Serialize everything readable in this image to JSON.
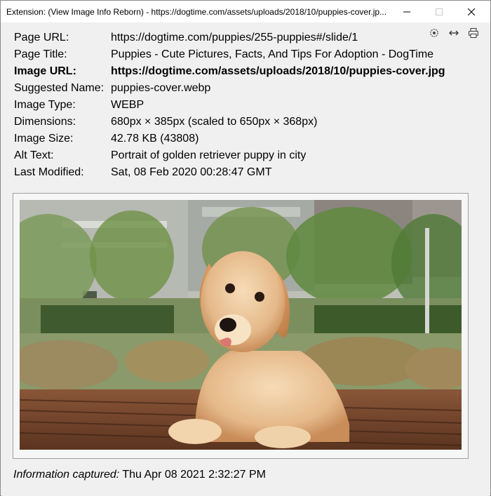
{
  "window": {
    "title": "Extension: (View Image Info Reborn) - https://dogtime.com/assets/uploads/2018/10/puppies-cover.jp..."
  },
  "info": [
    {
      "label": "Page URL:",
      "value": "https://dogtime.com/puppies/255-puppies#/slide/1",
      "bold": false
    },
    {
      "label": "Page Title:",
      "value": "Puppies - Cute Pictures, Facts, And Tips For Adoption - DogTime",
      "bold": false
    },
    {
      "label": "Image URL:",
      "value": "https://dogtime.com/assets/uploads/2018/10/puppies-cover.jpg",
      "bold": true
    },
    {
      "label": "Suggested Name:",
      "value": "puppies-cover.webp",
      "bold": false
    },
    {
      "label": "Image Type:",
      "value": "WEBP",
      "bold": false
    },
    {
      "label": "Dimensions:",
      "value": "680px × 385px (scaled to 650px × 368px)",
      "bold": false
    },
    {
      "label": "Image Size:",
      "value": "42.78 KB (43808)",
      "bold": false
    },
    {
      "label": "Alt Text:",
      "value": "Portrait of golden retriever puppy in city",
      "bold": false
    },
    {
      "label": "Last Modified:",
      "value": "Sat, 08 Feb 2020 00:28:47 GMT",
      "bold": false
    }
  ],
  "toolbar": {
    "icons": [
      "settings-icon",
      "resize-icon",
      "print-icon"
    ]
  },
  "image": {
    "subject": "golden retriever puppy on wooden bench"
  },
  "footer": {
    "label": "Information captured:",
    "value": "Thu Apr 08 2021 2:32:27 PM"
  }
}
